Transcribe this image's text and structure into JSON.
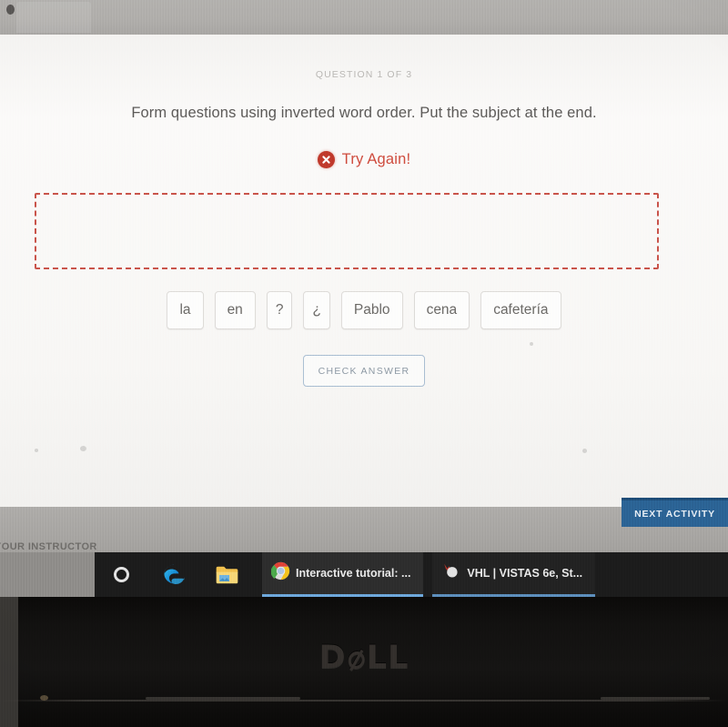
{
  "app": {
    "window_title": "Interactive tutorial",
    "brand_logo": "DELL"
  },
  "activity": {
    "question_counter": "QUESTION 1 OF 3",
    "prompt": "Form questions using inverted word order. Put the subject at the end.",
    "feedback": {
      "icon": "error-circle-x-icon",
      "text": "Try Again!",
      "color": "#cf4b3d",
      "state": "incorrect"
    },
    "answer_zone": {
      "value": "",
      "placeholder": "",
      "border_color": "#c9544a",
      "state": "empty"
    },
    "word_tiles": [
      {
        "label": "la",
        "narrow": false
      },
      {
        "label": "en",
        "narrow": false
      },
      {
        "label": "?",
        "narrow": true
      },
      {
        "label": "¿",
        "narrow": true
      },
      {
        "label": "Pablo",
        "narrow": false
      },
      {
        "label": "cena",
        "narrow": false
      },
      {
        "label": "cafetería",
        "narrow": false
      }
    ],
    "check_button": "CHECK ANSWER",
    "next_activity": "NEXT ACTIVITY",
    "instructor_link": "YOUR INSTRUCTOR"
  },
  "taskbar": {
    "icons": [
      {
        "name": "cortana-icon",
        "glyph": "ring"
      },
      {
        "name": "edge-icon",
        "glyph": "edge"
      },
      {
        "name": "file-explorer-icon",
        "glyph": "folder"
      }
    ],
    "windows": [
      {
        "label": "Interactive tutorial: ...",
        "icon": "chrome-icon"
      },
      {
        "label": "VHL | VISTAS 6e, St...",
        "icon": "vhl-icon"
      }
    ]
  },
  "colors": {
    "accent_blue": "#2b6395",
    "error_red": "#c0392b",
    "page_bg": "#f7f6f4",
    "taskbar_bg": "#1c1c1c"
  }
}
